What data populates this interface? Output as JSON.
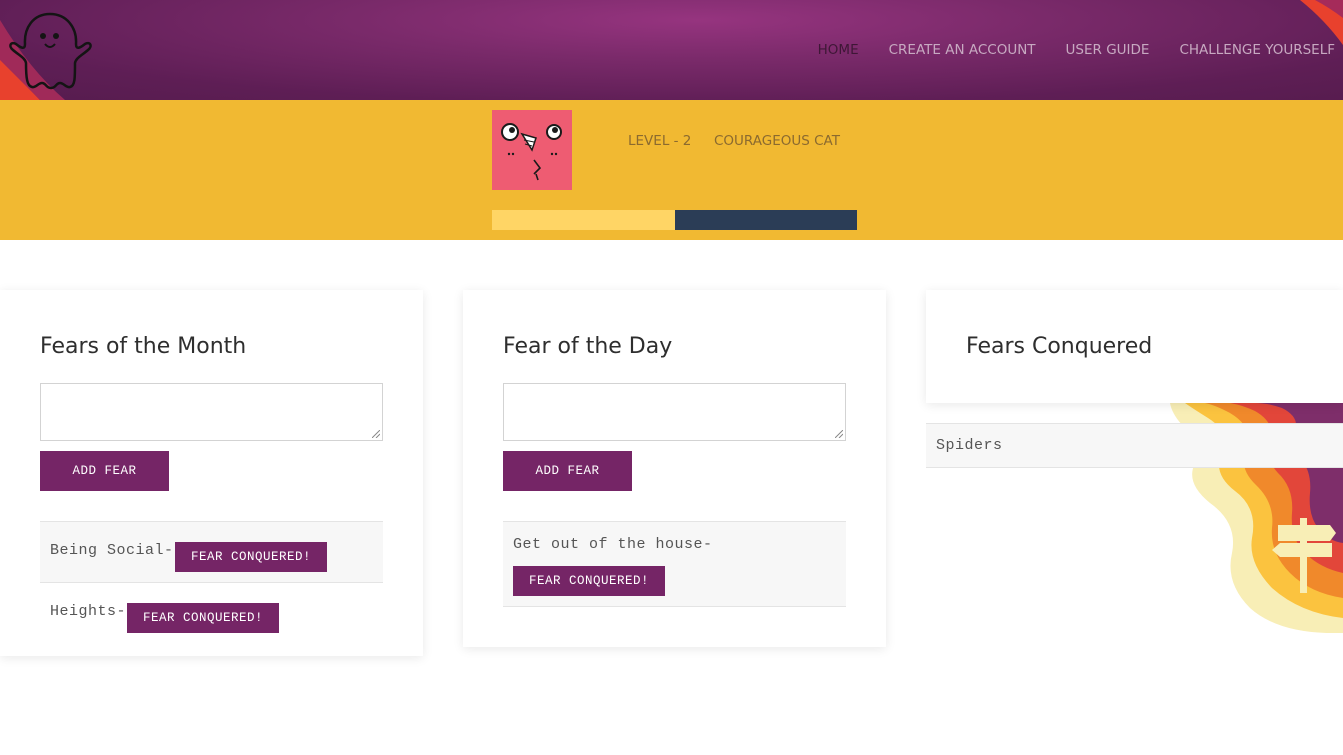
{
  "nav": {
    "items": [
      {
        "label": "HOME",
        "active": true
      },
      {
        "label": "CREATE AN ACCOUNT",
        "active": false
      },
      {
        "label": "USER GUIDE",
        "active": false
      },
      {
        "label": "CHALLENGE YOURSELF",
        "active": false
      }
    ]
  },
  "profile": {
    "level": "LEVEL - 2",
    "rank": "COURAGEOUS CAT",
    "progress_fraction": 0.5
  },
  "fears_month": {
    "title": "Fears of the Month",
    "input_value": "",
    "add_label": "ADD FEAR",
    "items": [
      {
        "text": "Being Social-",
        "button": "FEAR CONQUERED!"
      },
      {
        "text": "Heights-",
        "button": "FEAR CONQUERED!"
      }
    ]
  },
  "fear_day": {
    "title": "Fear of the Day",
    "input_value": "",
    "add_label": "ADD FEAR",
    "items": [
      {
        "text": "Get out of the house-",
        "button": "FEAR CONQUERED!"
      }
    ]
  },
  "fears_conquered": {
    "title": "Fears Conquered",
    "items": [
      {
        "text": "Spiders"
      }
    ]
  },
  "colors": {
    "header_purple": "#7a2a6a",
    "band_yellow": "#f1b932",
    "button_purple": "#752566",
    "progress_fill": "#ffd565",
    "progress_track": "#2b3d56",
    "avatar_pink": "#ee5c72"
  },
  "icons": [
    "ghost-logo-icon",
    "cat-face-avatar",
    "signpost-illustration"
  ]
}
